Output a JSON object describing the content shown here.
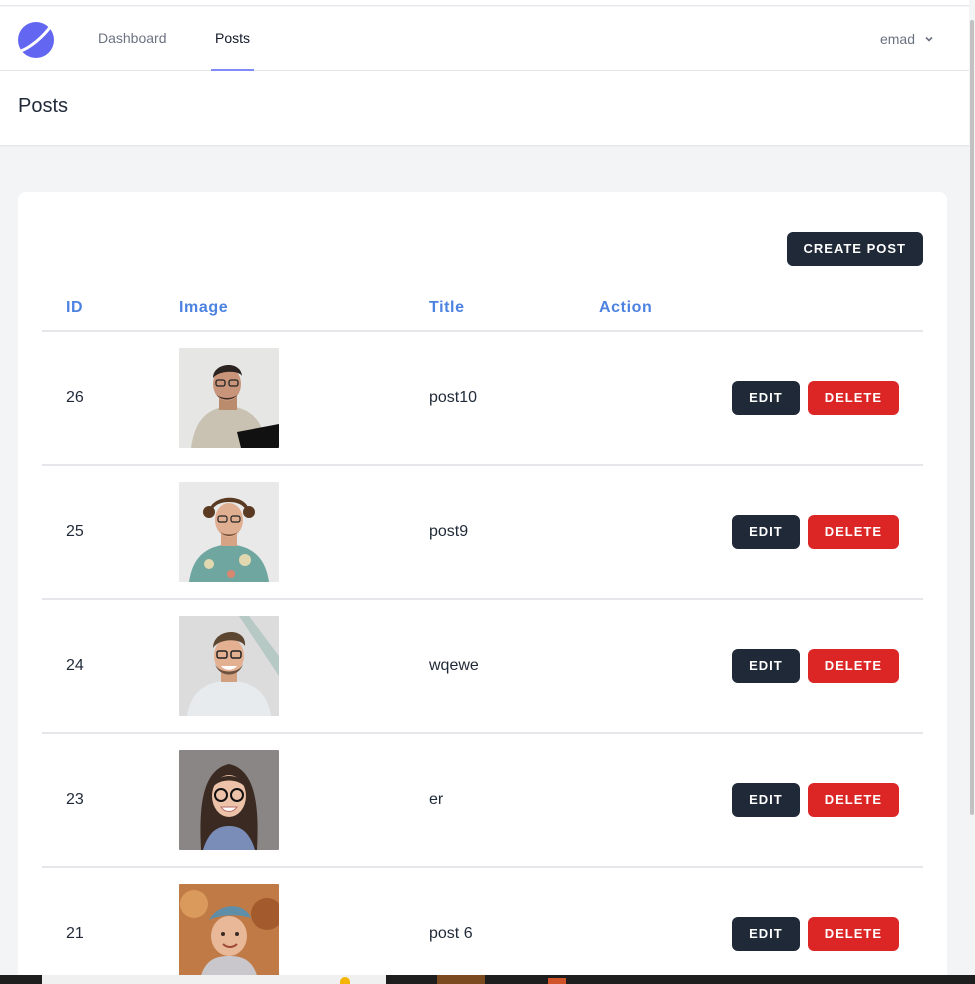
{
  "nav": {
    "links": [
      {
        "label": "Dashboard",
        "active": false
      },
      {
        "label": "Posts",
        "active": true
      }
    ],
    "user_name": "emad",
    "accent_color": "#818cf8"
  },
  "header": {
    "title": "Posts"
  },
  "card": {
    "create_label": "CREATE POST",
    "columns": [
      "ID",
      "Image",
      "Title",
      "Action"
    ],
    "edit_label": "EDIT",
    "delete_label": "DELETE",
    "rows": [
      {
        "id": "26",
        "title": "post10",
        "image": "man-glasses-white-shirt"
      },
      {
        "id": "25",
        "title": "post9",
        "image": "man-curly-hair-floral-shirt"
      },
      {
        "id": "24",
        "title": "wqewe",
        "image": "man-smiling-hoodie"
      },
      {
        "id": "23",
        "title": "er",
        "image": "woman-glasses-smiling"
      },
      {
        "id": "21",
        "title": "post 6",
        "image": "girl-headband-smiling"
      }
    ]
  },
  "colors": {
    "header_text": "#4c82e0",
    "dark_button": "#1f2937",
    "delete_button": "#dc2626"
  }
}
